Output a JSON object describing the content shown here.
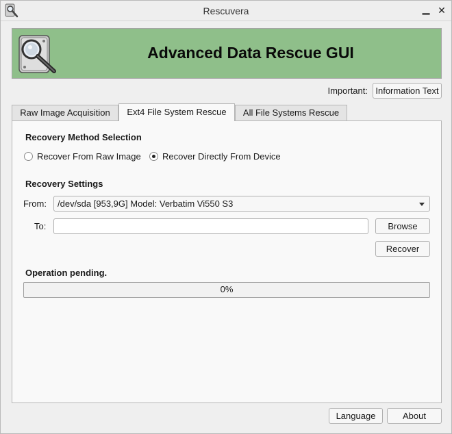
{
  "window": {
    "title": "Rescuvera",
    "app_icon": "magnifier-disk-icon",
    "minimize_glyph": "▁",
    "close_glyph": "✕"
  },
  "banner": {
    "heading": "Advanced Data Rescue GUI",
    "logo_icon": "hard-disk-magnifier-icon",
    "background_color": "#8fbf8a"
  },
  "important": {
    "label": "Important:",
    "button_label": "Information Text"
  },
  "tabs": [
    {
      "label": "Raw Image Acquisition",
      "active": false
    },
    {
      "label": "Ext4 File System Rescue",
      "active": true
    },
    {
      "label": "All File Systems Rescue",
      "active": false
    }
  ],
  "recovery_method": {
    "title": "Recovery Method Selection",
    "options": [
      {
        "label": "Recover From Raw Image",
        "checked": false
      },
      {
        "label": "Recover Directly From Device",
        "checked": true
      }
    ]
  },
  "recovery_settings": {
    "title": "Recovery Settings",
    "from_label": "From:",
    "from_value": "/dev/sda [953,9G] Model: Verbatim Vi550 S3",
    "to_label": "To:",
    "to_value": "",
    "browse_label": "Browse",
    "recover_label": "Recover"
  },
  "status": {
    "text": "Operation pending.",
    "progress_label": "0%",
    "progress_fraction": 0
  },
  "footer": {
    "language_label": "Language",
    "about_label": "About"
  }
}
